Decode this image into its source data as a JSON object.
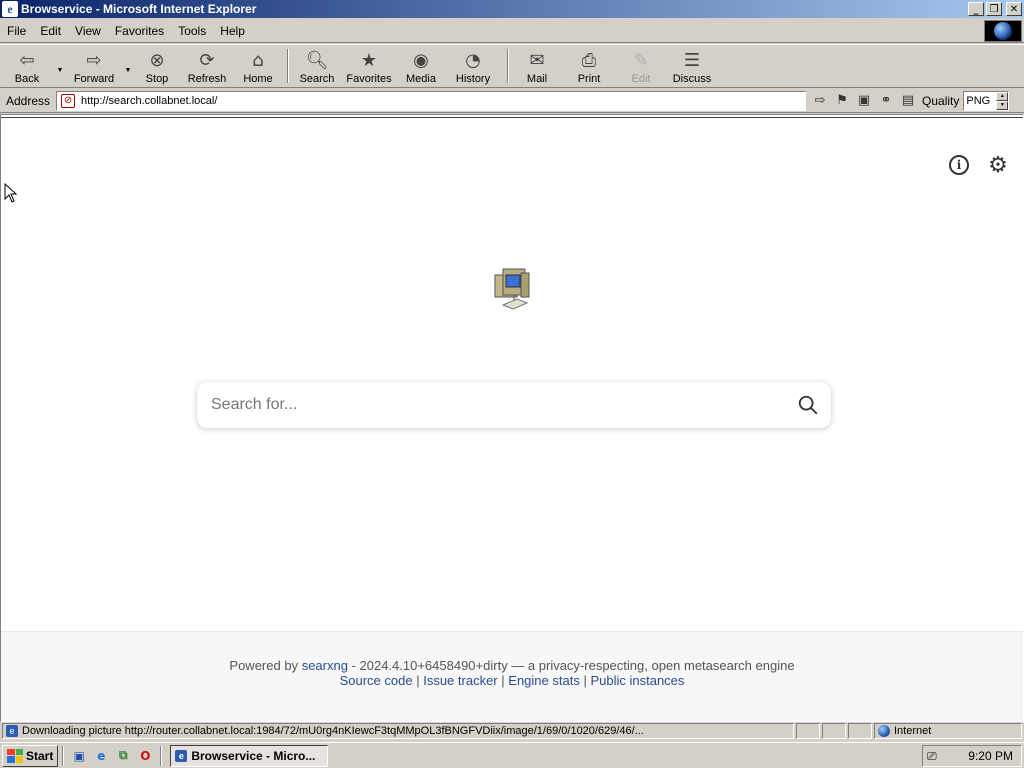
{
  "window": {
    "title": "Browservice - Microsoft Internet Explorer",
    "buttons": {
      "minimize": "_",
      "restore": "❐",
      "close": "✕"
    }
  },
  "menu": {
    "items": [
      "File",
      "Edit",
      "View",
      "Favorites",
      "Tools",
      "Help"
    ]
  },
  "toolbar": {
    "buttons": [
      {
        "label": "Back",
        "icon": "back-arrow-icon",
        "dropdown": true
      },
      {
        "label": "Forward",
        "icon": "forward-arrow-icon",
        "dropdown": true
      },
      {
        "label": "Stop",
        "icon": "stop-icon"
      },
      {
        "label": "Refresh",
        "icon": "refresh-icon"
      },
      {
        "label": "Home",
        "icon": "home-icon"
      },
      {
        "label": "Search",
        "icon": "search-icon"
      },
      {
        "label": "Favorites",
        "icon": "favorites-icon"
      },
      {
        "label": "Media",
        "icon": "media-icon"
      },
      {
        "label": "History",
        "icon": "history-icon"
      },
      {
        "label": "Mail",
        "icon": "mail-icon",
        "dropdown": true
      },
      {
        "label": "Print",
        "icon": "print-icon"
      },
      {
        "label": "Edit",
        "icon": "edit-icon",
        "disabled": true
      },
      {
        "label": "Discuss",
        "icon": "discuss-icon"
      }
    ]
  },
  "address": {
    "label": "Address",
    "url": "http://search.collabnet.local/",
    "quality_label": "Quality",
    "quality_value": "PNG"
  },
  "page": {
    "search_placeholder": "Search for...",
    "footer": {
      "powered_by": "Powered by",
      "engine_link": "searxng",
      "tagline": "- 2024.4.10+6458490+dirty — a privacy-respecting, open metasearch engine",
      "links": [
        "Source code",
        "Issue tracker",
        "Engine stats",
        "Public instances"
      ]
    }
  },
  "status": {
    "text": "Downloading picture http://router.collabnet.local:1984/72/mU0rg4nKIewcF3tqMMpOL3fBNGFVDiix/image/1/69/0/1020/629/46/...",
    "zone": "Internet"
  },
  "taskbar": {
    "start_label": "Start",
    "task_label": "Browservice - Micro...",
    "clock": "9:20 PM"
  },
  "colors": {
    "title_gradient_start": "#0a246a",
    "title_gradient_end": "#a6caf0",
    "chrome": "#d4d0c8",
    "link": "#2a4d8f"
  }
}
